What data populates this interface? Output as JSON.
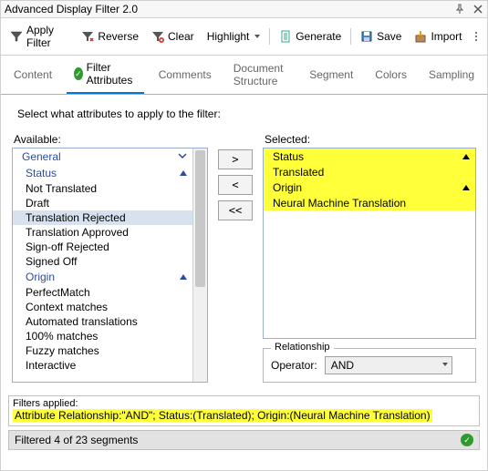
{
  "window": {
    "title": "Advanced Display Filter 2.0"
  },
  "toolbar": {
    "apply": "Apply Filter",
    "reverse": "Reverse",
    "clear": "Clear",
    "highlight": "Highlight",
    "generate": "Generate",
    "save": "Save",
    "import": "Import"
  },
  "tabs": {
    "content": "Content",
    "filter_attributes": "Filter Attributes",
    "comments": "Comments",
    "document_structure": "Document Structure",
    "segment": "Segment",
    "colors": "Colors",
    "sampling": "Sampling"
  },
  "instruction": "Select what attributes to apply to the filter:",
  "available": {
    "label": "Available:",
    "groups": {
      "general": "General",
      "status": "Status",
      "origin": "Origin"
    },
    "status_items": [
      "Not Translated",
      "Draft",
      "Translation Rejected",
      "Translation Approved",
      "Sign-off Rejected",
      "Signed Off"
    ],
    "origin_items": [
      "PerfectMatch",
      "Context matches",
      "Automated translations",
      "100% matches",
      "Fuzzy matches",
      "Interactive"
    ]
  },
  "move": {
    "right": ">",
    "left": "<",
    "allleft": "<<"
  },
  "selected": {
    "label": "Selected:",
    "groups": {
      "status": "Status",
      "origin": "Origin"
    },
    "status_item": "Translated",
    "origin_item": "Neural Machine Translation"
  },
  "relationship": {
    "legend": "Relationship",
    "operator_label": "Operator:",
    "operator_value": "AND"
  },
  "filters_applied": {
    "label": "Filters applied:",
    "value": "Attribute Relationship:\"AND\"; Status:(Translated); Origin:(Neural Machine Translation)"
  },
  "status": {
    "text": "Filtered 4 of 23 segments"
  }
}
